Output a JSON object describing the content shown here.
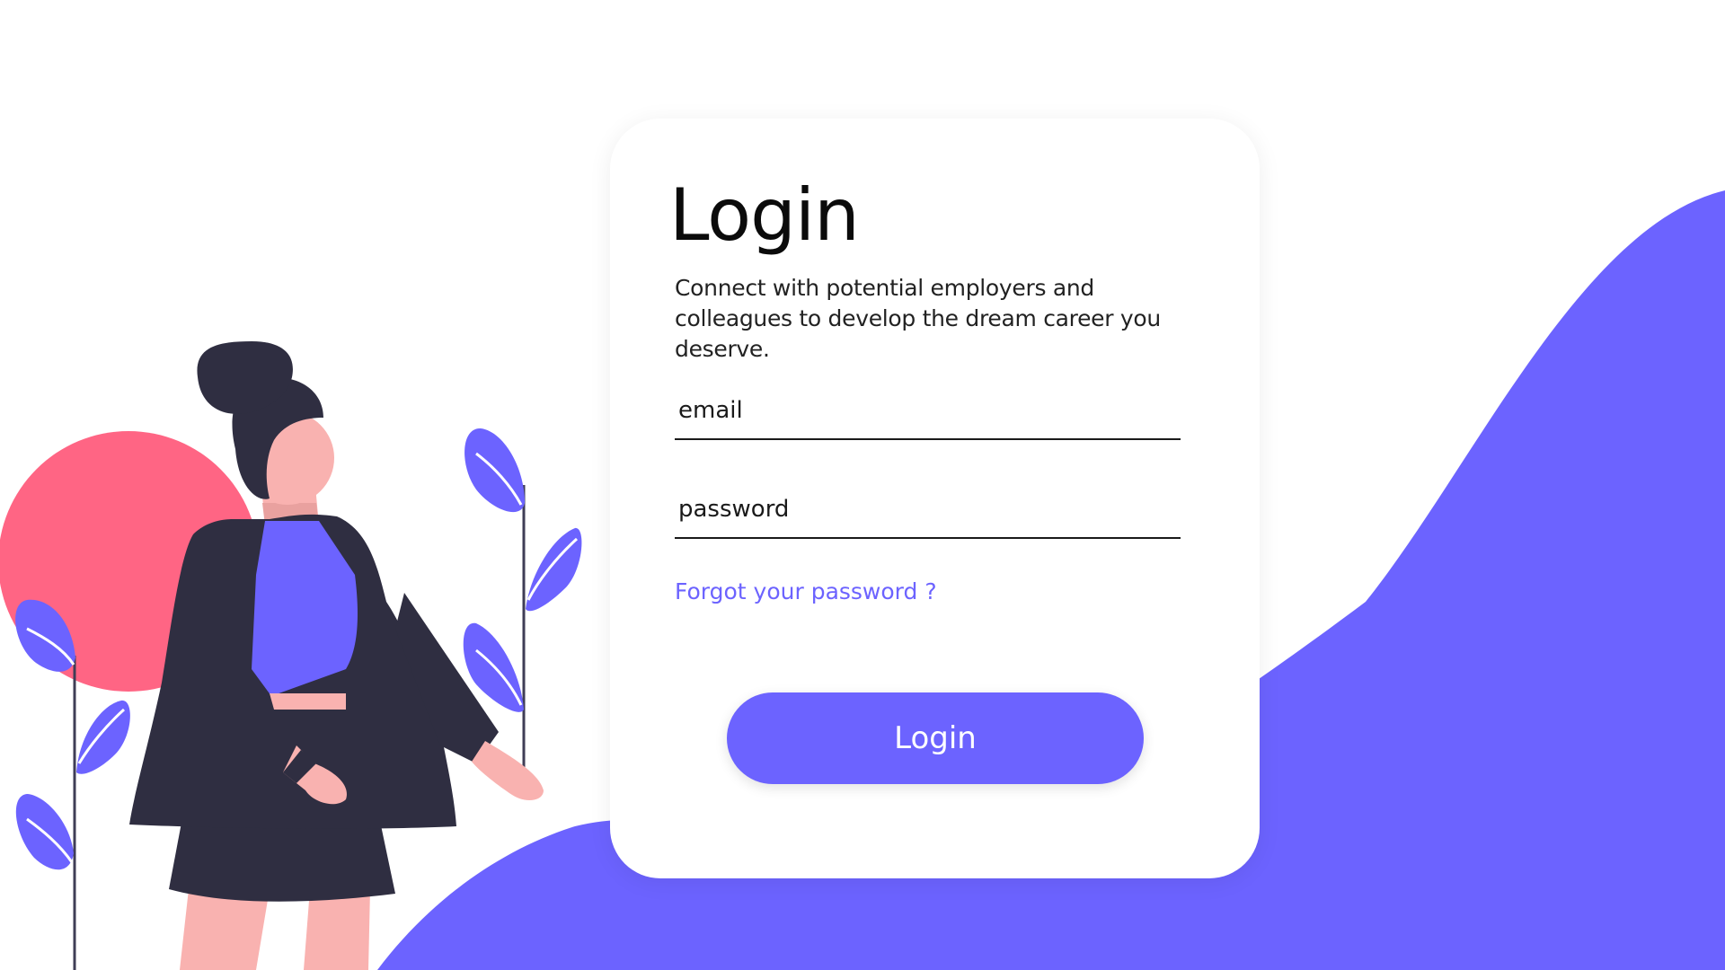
{
  "colors": {
    "accent": "#6c63ff",
    "circle": "#ff6584",
    "dark": "#2f2e41",
    "skin": "#f9b2b0"
  },
  "illustration": {
    "figure": "woman-figure",
    "decoration": [
      "sun-circle",
      "leaf-plant-left",
      "leaf-plant-right",
      "background-wave"
    ]
  },
  "login_card": {
    "title": "Login",
    "subtitle": "Connect with potential employers and colleagues to develop the dream career you deserve.",
    "email_placeholder": "email",
    "password_placeholder": "password",
    "forgot_link": "Forgot your password ?",
    "login_button": "Login"
  }
}
